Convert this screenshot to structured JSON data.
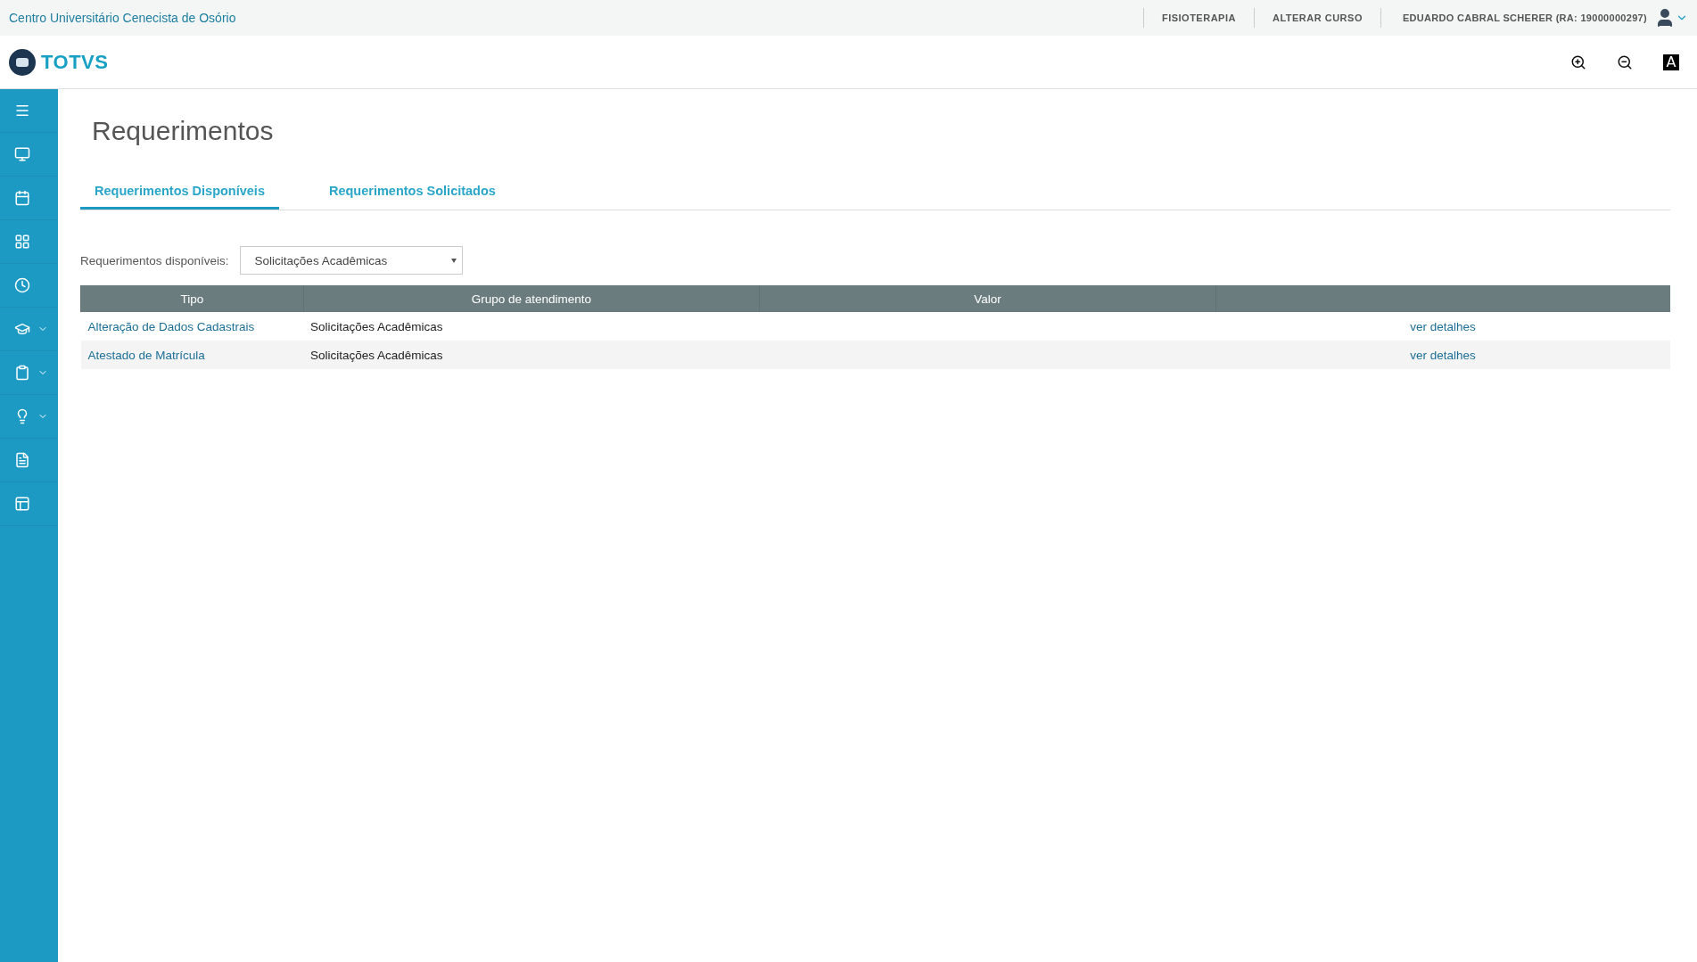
{
  "top_bar": {
    "institution": "Centro Universitário Cenecista de Osório",
    "links": [
      "FISIOTERAPIA",
      "ALTERAR CURSO"
    ],
    "user": "EDUARDO CABRAL SCHERER (RA: 19000000297)"
  },
  "header": {
    "logo": "TOTVS",
    "contrast_label": "A"
  },
  "sidebar": {
    "items": [
      {
        "expandable": false
      },
      {
        "expandable": false
      },
      {
        "expandable": false
      },
      {
        "expandable": false
      },
      {
        "expandable": false
      },
      {
        "expandable": true
      },
      {
        "expandable": true
      },
      {
        "expandable": true
      },
      {
        "expandable": false
      },
      {
        "expandable": false
      }
    ]
  },
  "page": {
    "title": "Requerimentos",
    "tabs": [
      {
        "label": "Requerimentos Disponíveis",
        "selected": true
      },
      {
        "label": "Requerimentos Solicitados",
        "selected": false
      }
    ],
    "filter": {
      "label": "Requerimentos disponíveis:",
      "value": "Solicitações Acadêmicas"
    },
    "table": {
      "columns": [
        "Tipo",
        "Grupo de atendimento",
        "Valor",
        ""
      ],
      "rows": [
        {
          "tipo": "Alteração de Dados Cadastrais",
          "grupo": "Solicitações Acadêmicas",
          "valor": "",
          "action": "ver detalhes"
        },
        {
          "tipo": "Atestado de Matrícula",
          "grupo": "Solicitações Acadêmicas",
          "valor": "",
          "action": "ver detalhes"
        }
      ]
    }
  }
}
